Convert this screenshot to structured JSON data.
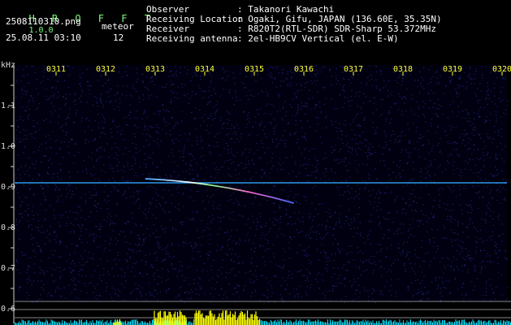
{
  "header": {
    "app_title": "H R O F F T",
    "version": "1.0.0",
    "filename": "2508110310.png",
    "timestamp": "25.08.11 03:10",
    "meteor_label": "meteor",
    "meteor_count": "12",
    "info_labels": [
      "Observer",
      "Receiving Location",
      "Receiver",
      "Receiving antenna"
    ],
    "info_values": [
      ": Takanori Kawachi",
      ": Ogaki, Gifu, JAPAN (136.60E, 35.35N)",
      ": R820T2(RTL-SDR) SDR-Sharp 53.372MHz",
      ": 2el-HB9CV Vertical (el. E-W)"
    ]
  },
  "spectrogram": {
    "y_unit": "kHz",
    "y_ticks": [
      "1.1",
      "1.0",
      "0.9",
      "0.8",
      "0.7",
      "0.6"
    ],
    "time_labels": [
      "0311",
      "0312",
      "0313",
      "0314",
      "0315",
      "0316",
      "0317",
      "0318",
      "0319",
      "0320"
    ],
    "carrier_khz": 0.91,
    "meteor_trace": {
      "start_time": "0312.8",
      "end_time": "0315.8",
      "start_khz": 0.92,
      "end_khz": 0.86
    },
    "colors": {
      "background": "#000010",
      "noise": "#1e1e6e",
      "carrier": "#33aaff",
      "activity_bars": "#ffff00",
      "baseline": "#00e5ff"
    }
  }
}
